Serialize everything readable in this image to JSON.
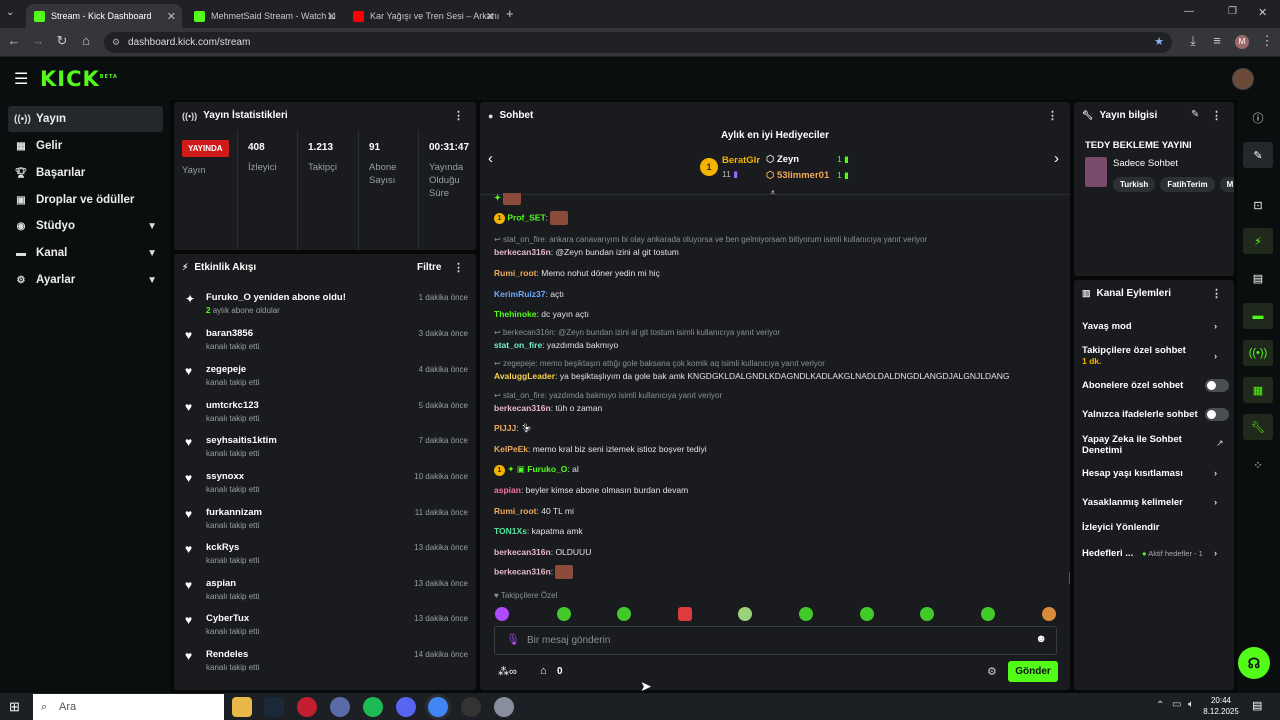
{
  "browser": {
    "tabs": [
      {
        "title": "Stream - Kick Dashboard",
        "color": "#53fc18"
      },
      {
        "title": "MehmetSaid Stream - Watch Li",
        "color": "#53fc18"
      },
      {
        "title": "Kar Yağışı ve Tren Sesi – Arkanı",
        "color": "#ff0000"
      }
    ],
    "url": "dashboard.kick.com/stream",
    "profile_initial": "M"
  },
  "kick": {
    "logo": "KICK",
    "beta": "BETA"
  },
  "sidebar": {
    "items": [
      {
        "label": "Yayın",
        "icon": "broadcast-icon"
      },
      {
        "label": "Gelir",
        "icon": "revenue-icon"
      },
      {
        "label": "Başarılar",
        "icon": "trophy-icon"
      },
      {
        "label": "Droplar ve ödüller",
        "icon": "gift-icon"
      },
      {
        "label": "Stüdyo",
        "icon": "studio-icon"
      },
      {
        "label": "Kanal",
        "icon": "channel-icon"
      },
      {
        "label": "Ayarlar",
        "icon": "gear-icon"
      }
    ]
  },
  "stats": {
    "title": "Yayın İstatistikleri",
    "live_badge": "YAYINDA",
    "live_label": "Yayın",
    "viewers": {
      "value": "408",
      "label": "İzleyici"
    },
    "followers": {
      "value": "1.213",
      "label": "Takipçi"
    },
    "subs": {
      "value": "91",
      "label": "Abone Sayısı"
    },
    "duration": {
      "value": "00:31:47",
      "label": "Yayında Olduğu Süre"
    }
  },
  "activity": {
    "title": "Etkinlik Akışı",
    "filter": "Filtre",
    "items": [
      {
        "name": "Furuko_O yeniden abone oldu!",
        "sub_count": "2",
        "sub": "aylık abone oldular",
        "time": "1 dakika önce"
      },
      {
        "name": "baran3856",
        "sub": "kanalı takip etti",
        "time": "3 dakika önce"
      },
      {
        "name": "zegepeje",
        "sub": "kanalı takip etti",
        "time": "4 dakika önce"
      },
      {
        "name": "umtcrkc123",
        "sub": "kanalı takip etti",
        "time": "5 dakika önce"
      },
      {
        "name": "seyhsaitis1ktim",
        "sub": "kanalı takip etti",
        "time": "7 dakika önce"
      },
      {
        "name": "ssynoxx",
        "sub": "kanalı takip etti",
        "time": "10 dakika önce"
      },
      {
        "name": "furkannizam",
        "sub": "kanalı takip etti",
        "time": "11 dakika önce"
      },
      {
        "name": "kckRys",
        "sub": "kanalı takip etti",
        "time": "13 dakika önce"
      },
      {
        "name": "aspian",
        "sub": "kanalı takip etti",
        "time": "13 dakika önce"
      },
      {
        "name": "CyberTux",
        "sub": "kanalı takip etti",
        "time": "13 dakika önce"
      },
      {
        "name": "Rendeles",
        "sub": "kanalı takip etti",
        "time": "14 dakika önce"
      }
    ]
  },
  "chat": {
    "title": "Sohbet",
    "gifters_title": "Aylık en iyi Hediyeciler",
    "gifters": [
      {
        "rank": "1",
        "name": "BeratGlr",
        "count": "11"
      },
      {
        "name": "Zeyn",
        "count": "1"
      },
      {
        "name": "53limmer01",
        "count": "1"
      }
    ],
    "messages": [
      {
        "user": "Prof_SET",
        "text": "",
        "color": "#53fc18",
        "emote": true
      },
      {
        "reply": "stat_on_fire: ankara canavarıyım bi olay ankarada oluyorsa ve ben gelmiyorsam bitiyorum isimli kullanıcıya yanıt veriyor"
      },
      {
        "user": "berkecan316n",
        "text": "@Zeyn bundan izini al git tostum",
        "color": "#e8b7c9"
      },
      {
        "user": "Rumi_root",
        "text": "Memo nohut döner yedin mi hiç",
        "color": "#f0a95a"
      },
      {
        "user": "KerimRuiz37",
        "text": "açtı",
        "color": "#6fa8ff"
      },
      {
        "user": "Thehinoke",
        "text": "dc yayın açtı",
        "color": "#53fc18"
      },
      {
        "reply": "berkecan316n: @Zeyn bundan izini al git tostum isimli kullanıcıya yanıt veriyor"
      },
      {
        "user": "stat_on_fire",
        "text": "yazdımda bakmıyo",
        "color": "#74f0c5"
      },
      {
        "reply": "zegepeje: memo beşiktaşın attığı gole baksana çok komik aq isimli kullanıcıya yanıt veriyor"
      },
      {
        "user": "AvaluggLeader",
        "text": "ya beşiktaşlıyım da gole bak amk KNGDGKLDALGNDLKDAGNDLKADLAKGLNADLDALDNGDLANGDJALGNJLDANG",
        "color": "#f7d24a"
      },
      {
        "reply": "stat_on_fire: yazdımda bakmıyo isimli kullanıcıya yanıt veriyor"
      },
      {
        "user": "berkecan316n",
        "text": "tüh o zaman",
        "color": "#e8b7c9"
      },
      {
        "user": "PIJJJ",
        "text": "",
        "color": "#f0a95a",
        "emote": true
      },
      {
        "user": "KelPeEk",
        "text": "memo kral biz seni izlemek istioz boşver tediyi",
        "color": "#f0a95a"
      },
      {
        "user": "Furuko_O",
        "text": "al",
        "color": "#53fc18"
      },
      {
        "user": "aspian",
        "text": "beyler kimse abone olmasın burdan devam",
        "color": "#ff6fa8"
      },
      {
        "user": "Rumi_root",
        "text": "40 TL mi",
        "color": "#f0a95a"
      },
      {
        "user": "TON1Xs",
        "text": "kapatma amk",
        "color": "#53e4a0"
      },
      {
        "user": "berkecan316n",
        "text": "OLDUUU",
        "color": "#e8b7c9"
      },
      {
        "user": "berkecan316n",
        "text": "",
        "color": "#e8b7c9",
        "emote": true
      }
    ],
    "followers_only": "Takipçilere Özel",
    "input_placeholder": "Bir mesaj gönderin",
    "points": "0",
    "send": "Gönder"
  },
  "info": {
    "title": "Yayın bilgisi",
    "stream_title": "TEDY BEKLEME YAYINI",
    "category": "Sadece Sohbet",
    "tags": [
      "Turkish",
      "FatihTerim",
      "M"
    ]
  },
  "actions": {
    "title": "Kanal Eylemleri",
    "slow_mode": "Yavaş mod",
    "followers_only": "Takipçilere özel sohbet",
    "followers_only_value": "1 dk.",
    "subs_only": "Abonelere özel sohbet",
    "emotes_only": "Yalnızca ifadelerle sohbet",
    "ai_moderation": "Yapay Zeka ile Sohbet Denetimi",
    "age_restriction": "Hesap yaşı kısıtlaması",
    "banned_words": "Yasaklanmış kelimeler",
    "redirect": "İzleyici Yönlendir",
    "goals": "Hedefleri ...",
    "goals_status": "Aktif hedefler - 1"
  },
  "taskbar": {
    "search": "Ara",
    "time": "20:44",
    "date": "8.12.2025"
  }
}
